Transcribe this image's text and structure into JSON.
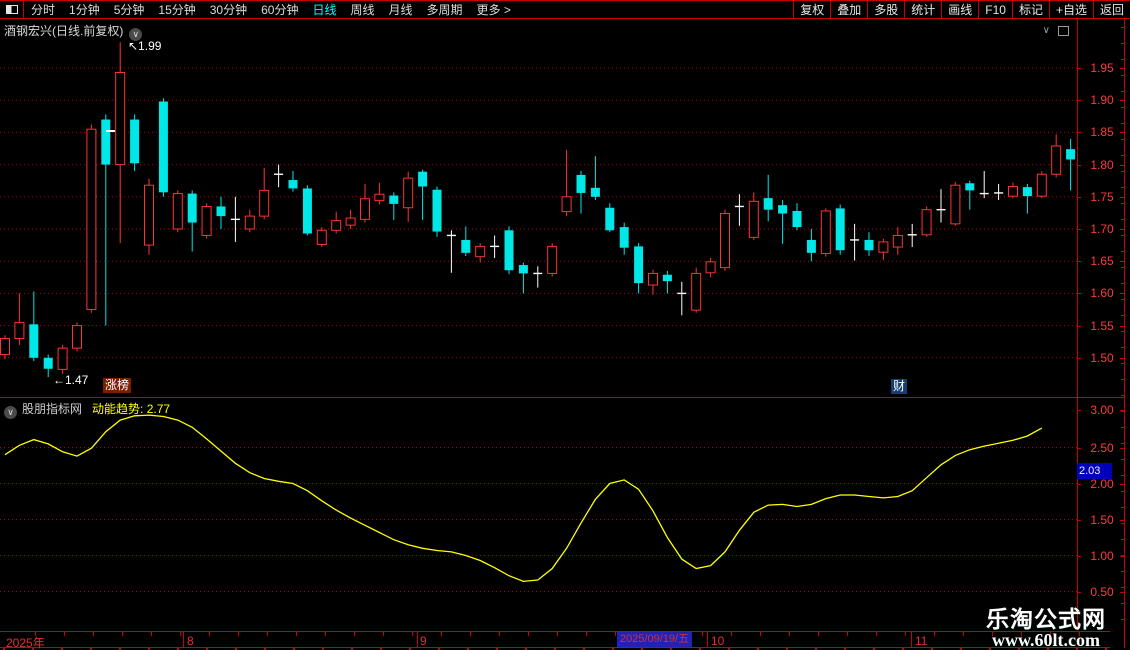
{
  "menubar": {
    "window_icon": "split-window-icon",
    "left_items": [
      {
        "label": "分时",
        "active": false
      },
      {
        "label": "1分钟",
        "active": false
      },
      {
        "label": "5分钟",
        "active": false
      },
      {
        "label": "15分钟",
        "active": false
      },
      {
        "label": "30分钟",
        "active": false
      },
      {
        "label": "60分钟",
        "active": false
      },
      {
        "label": "日线",
        "active": true
      },
      {
        "label": "周线",
        "active": false
      },
      {
        "label": "月线",
        "active": false
      },
      {
        "label": "多周期",
        "active": false
      },
      {
        "label": "更多 >",
        "active": false
      }
    ],
    "right_items": [
      "复权",
      "叠加",
      "多股",
      "统计",
      "画线",
      "F10",
      "标记",
      "+自选",
      "返回"
    ]
  },
  "main_chart": {
    "title": "酒钢宏兴(日线.前复权)",
    "high_annotation": "1.99",
    "low_annotation": "1.47",
    "tag_hot": "涨榜",
    "tag_fin": "财",
    "axis_ticks": [
      "1.95",
      "1.90",
      "1.85",
      "1.80",
      "1.75",
      "1.70",
      "1.65",
      "1.60",
      "1.55",
      "1.50"
    ],
    "chart_data": {
      "type": "candlestick",
      "title": "酒钢宏兴 daily candles, 前复权 (forward adjusted)",
      "ylim": [
        1.45,
        2.0
      ],
      "grid": "horizontal-dotted",
      "up_color": "#ff3232",
      "down_color": "#00e7e7",
      "doji_color": "#ffffff",
      "ohlc": [
        [
          1.505,
          1.535,
          1.498,
          1.53
        ],
        [
          1.53,
          1.6,
          1.52,
          1.555
        ],
        [
          1.552,
          1.603,
          1.495,
          1.5
        ],
        [
          1.5,
          1.505,
          1.47,
          1.483
        ],
        [
          1.482,
          1.52,
          1.475,
          1.515
        ],
        [
          1.515,
          1.555,
          1.51,
          1.55
        ],
        [
          1.575,
          1.862,
          1.57,
          1.855
        ],
        [
          1.87,
          1.878,
          1.55,
          1.8
        ],
        [
          1.8,
          1.99,
          1.678,
          1.943
        ],
        [
          1.87,
          1.878,
          1.79,
          1.802
        ],
        [
          1.675,
          1.778,
          1.66,
          1.768
        ],
        [
          1.898,
          1.903,
          1.75,
          1.757
        ],
        [
          1.7,
          1.76,
          1.695,
          1.755
        ],
        [
          1.755,
          1.76,
          1.665,
          1.71
        ],
        [
          1.69,
          1.74,
          1.685,
          1.735
        ],
        [
          1.735,
          1.75,
          1.7,
          1.72
        ],
        [
          1.715,
          1.75,
          1.68,
          1.715
        ],
        [
          1.7,
          1.73,
          1.695,
          1.72
        ],
        [
          1.72,
          1.795,
          1.715,
          1.76
        ],
        [
          1.785,
          1.8,
          1.765,
          1.785
        ],
        [
          1.776,
          1.79,
          1.758,
          1.763
        ],
        [
          1.763,
          1.768,
          1.69,
          1.693
        ],
        [
          1.676,
          1.703,
          1.672,
          1.698
        ],
        [
          1.698,
          1.727,
          1.693,
          1.713
        ],
        [
          1.706,
          1.73,
          1.7,
          1.717
        ],
        [
          1.715,
          1.77,
          1.71,
          1.747
        ],
        [
          1.744,
          1.772,
          1.738,
          1.754
        ],
        [
          1.752,
          1.757,
          1.714,
          1.739
        ],
        [
          1.733,
          1.789,
          1.711,
          1.779
        ],
        [
          1.789,
          1.792,
          1.714,
          1.766
        ],
        [
          1.761,
          1.766,
          1.688,
          1.696
        ],
        [
          1.69,
          1.698,
          1.632,
          1.69
        ],
        [
          1.683,
          1.704,
          1.658,
          1.663
        ],
        [
          1.657,
          1.678,
          1.648,
          1.673
        ],
        [
          1.673,
          1.69,
          1.655,
          1.673
        ],
        [
          1.698,
          1.704,
          1.63,
          1.636
        ],
        [
          1.644,
          1.648,
          1.6,
          1.631
        ],
        [
          1.631,
          1.642,
          1.609,
          1.631
        ],
        [
          1.631,
          1.678,
          1.626,
          1.673
        ],
        [
          1.727,
          1.823,
          1.72,
          1.75
        ],
        [
          1.784,
          1.79,
          1.724,
          1.756
        ],
        [
          1.764,
          1.813,
          1.745,
          1.75
        ],
        [
          1.733,
          1.74,
          1.695,
          1.698
        ],
        [
          1.703,
          1.71,
          1.66,
          1.671
        ],
        [
          1.673,
          1.678,
          1.6,
          1.616
        ],
        [
          1.613,
          1.637,
          1.598,
          1.631
        ],
        [
          1.629,
          1.635,
          1.6,
          1.619
        ],
        [
          1.6,
          1.618,
          1.566,
          1.6
        ],
        [
          1.574,
          1.64,
          1.57,
          1.631
        ],
        [
          1.632,
          1.655,
          1.625,
          1.649
        ],
        [
          1.64,
          1.73,
          1.635,
          1.724
        ],
        [
          1.735,
          1.754,
          1.705,
          1.735
        ],
        [
          1.687,
          1.757,
          1.683,
          1.743
        ],
        [
          1.748,
          1.784,
          1.712,
          1.73
        ],
        [
          1.737,
          1.745,
          1.677,
          1.724
        ],
        [
          1.728,
          1.74,
          1.698,
          1.703
        ],
        [
          1.683,
          1.7,
          1.65,
          1.663
        ],
        [
          1.662,
          1.732,
          1.657,
          1.728
        ],
        [
          1.732,
          1.738,
          1.66,
          1.667
        ],
        [
          1.683,
          1.708,
          1.651,
          1.683
        ],
        [
          1.683,
          1.695,
          1.658,
          1.667
        ],
        [
          1.664,
          1.685,
          1.652,
          1.68
        ],
        [
          1.672,
          1.703,
          1.66,
          1.69
        ],
        [
          1.691,
          1.708,
          1.672,
          1.691
        ],
        [
          1.691,
          1.735,
          1.688,
          1.73
        ],
        [
          1.73,
          1.762,
          1.71,
          1.73
        ],
        [
          1.708,
          1.773,
          1.705,
          1.768
        ],
        [
          1.771,
          1.775,
          1.73,
          1.76
        ],
        [
          1.755,
          1.79,
          1.748,
          1.755
        ],
        [
          1.756,
          1.77,
          1.745,
          1.756
        ],
        [
          1.751,
          1.772,
          1.748,
          1.766
        ],
        [
          1.765,
          1.77,
          1.724,
          1.751
        ],
        [
          1.751,
          1.79,
          1.748,
          1.785
        ],
        [
          1.785,
          1.847,
          1.78,
          1.829
        ],
        [
          1.824,
          1.84,
          1.76,
          1.808
        ]
      ]
    }
  },
  "sub_chart": {
    "source": "股朋指标网",
    "indicator_label": "动能趋势:",
    "indicator_value": "2.77",
    "axis_ticks": [
      "3.00",
      "2.50",
      "2.00",
      "1.50",
      "1.00",
      "0.50"
    ],
    "axis_badge": "2.03",
    "chart_data": {
      "type": "line",
      "title": "动能趋势 momentum-trend indicator",
      "ylim": [
        0.3,
        3.2
      ],
      "grid": "horizontal-dotted",
      "legend_position": "top-left",
      "series": [
        {
          "name": "动能趋势",
          "color": "#ffff00",
          "values": [
            2.4,
            2.53,
            2.61,
            2.55,
            2.44,
            2.38,
            2.49,
            2.72,
            2.88,
            2.94,
            2.95,
            2.93,
            2.88,
            2.78,
            2.62,
            2.45,
            2.28,
            2.15,
            2.07,
            2.03,
            2.0,
            1.9,
            1.76,
            1.63,
            1.52,
            1.42,
            1.32,
            1.22,
            1.15,
            1.1,
            1.07,
            1.05,
            1.0,
            0.93,
            0.83,
            0.72,
            0.64,
            0.66,
            0.82,
            1.1,
            1.45,
            1.78,
            2.0,
            2.05,
            1.92,
            1.62,
            1.25,
            0.95,
            0.82,
            0.86,
            1.05,
            1.35,
            1.6,
            1.7,
            1.71,
            1.68,
            1.71,
            1.79,
            1.84,
            1.84,
            1.82,
            1.8,
            1.82,
            1.9,
            2.08,
            2.26,
            2.39,
            2.47,
            2.52,
            2.56,
            2.6,
            2.66,
            2.77
          ]
        }
      ]
    }
  },
  "x_axis": {
    "labels": [
      {
        "text": "2025年",
        "x": 6
      },
      {
        "text": "8",
        "x": 187
      },
      {
        "text": "9",
        "x": 420
      },
      {
        "text": "10",
        "x": 711
      },
      {
        "text": "11",
        "x": 915
      }
    ],
    "month_separators": [
      183,
      417,
      707,
      911
    ],
    "selected_date": "2025/09/19/五"
  },
  "watermark": {
    "line1": "乐淘公式网",
    "line2": "www.60lt.com"
  },
  "colors": {
    "accent_red": "#c80000",
    "axis_text_red": "#ff3a3a",
    "candle_up": "#ff3232",
    "candle_down": "#00e7e7",
    "indicator_yellow": "#ffff00",
    "active_tab_cyan": "#00ffff",
    "badge_blue": "#0000bb",
    "date_badge_blue": "#2222b8"
  }
}
